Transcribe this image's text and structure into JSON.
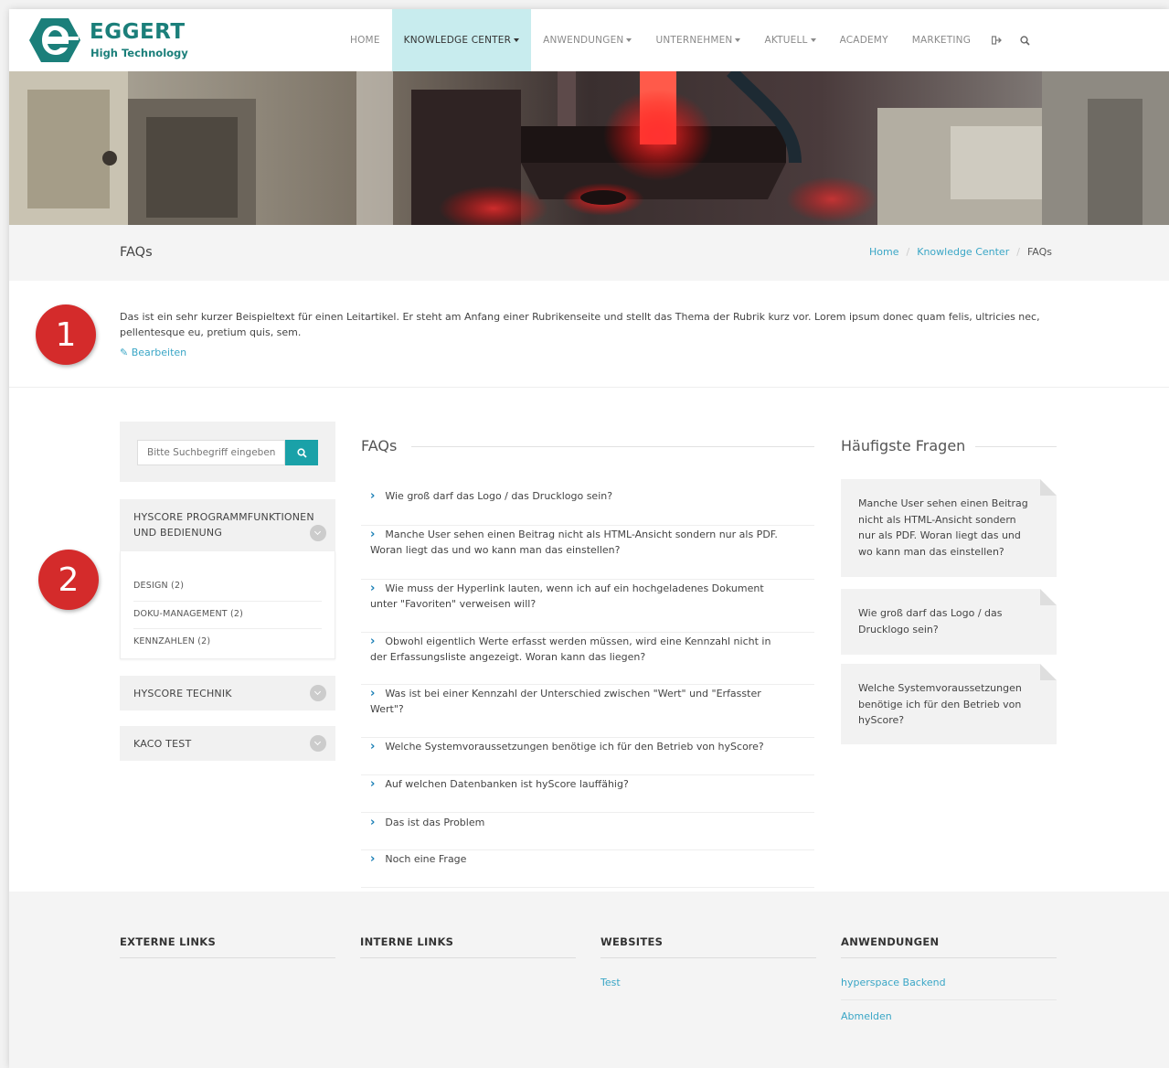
{
  "brand": {
    "name": "EGGERT",
    "tagline": "High Technology",
    "color": "#1b7f7a"
  },
  "nav": {
    "items": [
      {
        "label": "HOME",
        "dropdown": false,
        "active": false
      },
      {
        "label": "KNOWLEDGE CENTER",
        "dropdown": true,
        "active": true
      },
      {
        "label": "ANWENDUNGEN",
        "dropdown": true,
        "active": false
      },
      {
        "label": "UNTERNEHMEN",
        "dropdown": true,
        "active": false
      },
      {
        "label": "AKTUELL",
        "dropdown": true,
        "active": false
      },
      {
        "label": "ACADEMY",
        "dropdown": false,
        "active": false
      },
      {
        "label": "MARKETING",
        "dropdown": false,
        "active": false
      }
    ],
    "icons": [
      "sign-out-icon",
      "search-icon"
    ]
  },
  "titlebar": {
    "title": "FAQs",
    "breadcrumb": [
      "Home",
      "Knowledge Center",
      "FAQs"
    ],
    "separator": "/"
  },
  "intro": {
    "text": "Das ist ein sehr kurzer Beispieltext für einen Leitartikel. Er steht am Anfang einer Rubrikenseite und stellt das Thema der Rubrik kurz vor. Lorem ipsum donec quam felis, ultricies nec, pellentesque eu, pretium quis, sem.",
    "edit_label": "Bearbeiten"
  },
  "badges": [
    "1",
    "2"
  ],
  "search": {
    "placeholder": "Bitte Suchbegriff eingeben"
  },
  "categories": [
    {
      "title_line1": "HYSCORE PROGRAMMFUNKTIONEN",
      "title_line2": "UND BEDIENUNG",
      "items": [
        "DESIGN (2)",
        "DOKU-MANAGEMENT (2)",
        "KENNZAHLEN (2)"
      ]
    },
    {
      "title_line1": "HYSCORE TECHNIK"
    },
    {
      "title_line1": "KACO TEST"
    }
  ],
  "faqs": {
    "heading": "FAQs",
    "items": [
      {
        "line1": "Wie groß darf das Logo / das Drucklogo sein?"
      },
      {
        "line1": "Manche User sehen einen Beitrag nicht als HTML-Ansicht sondern nur als PDF.",
        "line2": "Woran liegt das und wo kann man das einstellen?"
      },
      {
        "line1": "Wie muss der Hyperlink lauten, wenn ich auf ein hochgeladenes Dokument",
        "line2": "unter \"Favoriten\" verweisen will?"
      },
      {
        "line1": "Obwohl eigentlich Werte erfasst werden müssen, wird eine Kennzahl nicht in",
        "line2": "der Erfassungsliste angezeigt. Woran kann das liegen?"
      },
      {
        "line1": "Was ist bei einer Kennzahl der Unterschied zwischen \"Wert\" und \"Erfasster",
        "line2": "Wert\"?"
      },
      {
        "line1": "Welche Systemvoraussetzungen benötige ich für den Betrieb von hyScore?"
      },
      {
        "line1": "Auf welchen Datenbanken ist hyScore lauffähig?"
      },
      {
        "line1": "Das ist das Problem"
      },
      {
        "line1": "Noch eine Frage"
      }
    ]
  },
  "top_questions": {
    "heading": "Häufigste Fragen",
    "cards": [
      {
        "lines": [
          "Manche User sehen einen Beitrag",
          "nicht als HTML-Ansicht sondern",
          "nur als PDF. Woran liegt das und",
          "wo kann man das einstellen?"
        ]
      },
      {
        "lines": [
          "Wie groß darf das Logo / das",
          "Drucklogo sein?"
        ]
      },
      {
        "lines": [
          "Welche Systemvoraussetzungen",
          "benötige ich für den Betrieb von",
          "hyScore?"
        ]
      }
    ]
  },
  "footer": {
    "columns": [
      {
        "title": "EXTERNE LINKS",
        "links": []
      },
      {
        "title": "INTERNE LINKS",
        "links": []
      },
      {
        "title": "WEBSITES",
        "links": [
          "Test"
        ]
      },
      {
        "title": "ANWENDUNGEN",
        "links": [
          "hyperspace Backend",
          "Abmelden"
        ]
      }
    ]
  },
  "colors": {
    "accent": "#1aa1a8",
    "link": "#3aa6c6",
    "active_nav": "#c8ecee",
    "badge": "#d42b2b"
  }
}
